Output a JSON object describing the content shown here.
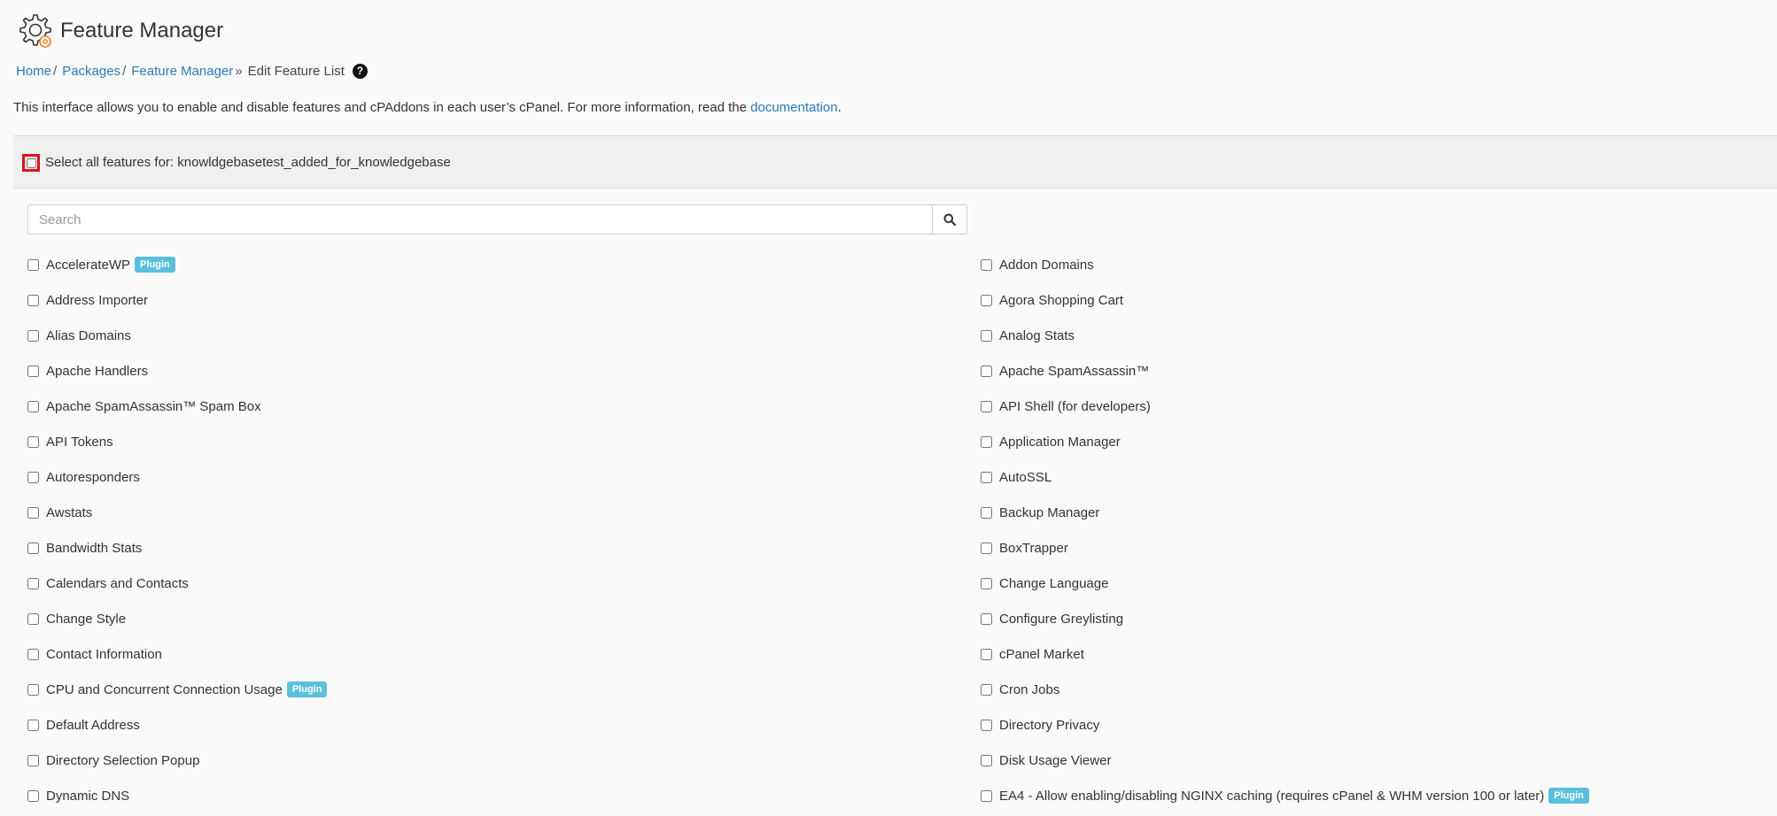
{
  "header": {
    "title": "Feature Manager",
    "logo_icon": "gear-icon"
  },
  "breadcrumb": {
    "items": [
      {
        "label": "Home",
        "sep": "/"
      },
      {
        "label": "Packages",
        "sep": "/"
      },
      {
        "label": "Feature Manager",
        "sep": "»"
      }
    ],
    "current": "Edit Feature List",
    "help_icon": "?"
  },
  "intro": {
    "text": "This interface allows you to enable and disable features and cPAddons in each user’s cPanel. For more information, read the ",
    "link": "documentation",
    "end": "."
  },
  "select_all": {
    "label": "Select all features for: knowldgebasetest_added_for_knowledgebase",
    "checked": false
  },
  "search": {
    "placeholder": "Search",
    "value": ""
  },
  "features": {
    "left": [
      {
        "label": "AccelerateWP",
        "badge": "Plugin"
      },
      {
        "label": "Address Importer"
      },
      {
        "label": "Alias Domains"
      },
      {
        "label": "Apache Handlers"
      },
      {
        "label": "Apache SpamAssassin™ Spam Box"
      },
      {
        "label": "API Tokens"
      },
      {
        "label": "Autoresponders"
      },
      {
        "label": "Awstats"
      },
      {
        "label": "Bandwidth Stats"
      },
      {
        "label": "Calendars and Contacts"
      },
      {
        "label": "Change Style"
      },
      {
        "label": "Contact Information"
      },
      {
        "label": "CPU and Concurrent Connection Usage",
        "badge": "Plugin"
      },
      {
        "label": "Default Address"
      },
      {
        "label": "Directory Selection Popup"
      },
      {
        "label": "Dynamic DNS"
      }
    ],
    "right": [
      {
        "label": "Addon Domains"
      },
      {
        "label": "Agora Shopping Cart"
      },
      {
        "label": "Analog Stats"
      },
      {
        "label": "Apache SpamAssassin™"
      },
      {
        "label": "API Shell (for developers)"
      },
      {
        "label": "Application Manager"
      },
      {
        "label": "AutoSSL"
      },
      {
        "label": "Backup Manager"
      },
      {
        "label": "BoxTrapper"
      },
      {
        "label": "Change Language"
      },
      {
        "label": "Configure Greylisting"
      },
      {
        "label": "cPanel Market"
      },
      {
        "label": "Cron Jobs"
      },
      {
        "label": "Directory Privacy"
      },
      {
        "label": "Disk Usage Viewer"
      },
      {
        "label": "EA4 - Allow enabling/disabling NGINX caching (requires cPanel & WHM version 100 or later)",
        "badge": "Plugin"
      }
    ]
  },
  "colors": {
    "link": "#2a7ab8",
    "badge": "#5bc0de",
    "highlight": "#e3101c"
  }
}
